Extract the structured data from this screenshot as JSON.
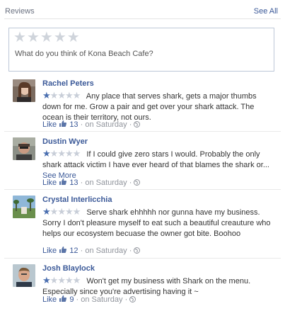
{
  "header": {
    "title": "Reviews",
    "see_all": "See All"
  },
  "composer": {
    "prompt": "What do you think of Kona Beach Cafe?"
  },
  "reviews": [
    {
      "name": "Rachel Peters",
      "rating": 1,
      "text": "Any place that serves shark, gets a major thumbs down for me. Grow a pair and get over your shark attack. The ocean is their territory, not ours.",
      "more": "",
      "like": "Like",
      "likes": "13",
      "time": "on Saturday"
    },
    {
      "name": "Dustin Wyer",
      "rating": 1,
      "text": "If I could give zero stars I would. Probably the only shark attack victim I have ever heard of that blames the shark or...",
      "more": "See More",
      "like": "Like",
      "likes": "13",
      "time": "on Saturday"
    },
    {
      "name": "Crystal Interlicchia",
      "rating": 1,
      "text": "Serve shark ehhhhh nor gunna have my business. Sorry I don't pleasure myself to eat such a beautiful creauture who helps our ecosystem becuase the owner got bite. Boohoo",
      "more": "",
      "like": "Like",
      "likes": "12",
      "time": "on Saturday"
    },
    {
      "name": "Josh Blaylock",
      "rating": 1,
      "text": "Won't get my business with Shark on the menu. Especially since you're advertising having it ~",
      "more": "",
      "like": "Like",
      "likes": "9",
      "time": "on Saturday"
    }
  ],
  "colors": {
    "link": "#3b5998",
    "star_on": "#4b6fb0",
    "star_off": "#c8ced8"
  },
  "icons": {
    "like": "thumbs-up-icon",
    "audience": "globe-icon"
  }
}
